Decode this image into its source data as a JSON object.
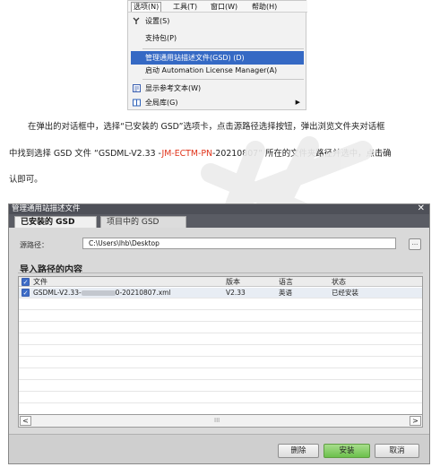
{
  "menu": {
    "bar": [
      "选项(N)",
      "工具(T)",
      "窗口(W)",
      "帮助(H)"
    ],
    "items": [
      {
        "icon": "settings-icon",
        "label": "设置(S)"
      },
      {
        "icon": "",
        "label": "支持包(P)"
      },
      {
        "icon": "",
        "label": "管理通用站描述文件(GSD) (D)"
      },
      {
        "icon": "",
        "label": "启动 Automation License Manager(A)"
      },
      {
        "icon": "reference-text-icon",
        "label": "显示参考文本(W)"
      },
      {
        "icon": "global-library-icon",
        "label": "全局库(G)"
      }
    ]
  },
  "article": {
    "line1": "在弹出的对话框中，选择“已安装的 GSD”选项卡，点击源路径选择按钮，弹出浏览文件夹对话框",
    "line2_a": "中找到选择 GSD 文件 “GSDML-V2.33 -",
    "line2_red": "JM-ECTM-PN",
    "line2_b": "-20210807” 所在的文件夹路径并选中，点击确",
    "line3": "认即可。"
  },
  "dialog": {
    "title": "管理通用站描述文件",
    "tabs": [
      "已安装的 GSD",
      "项目中的 GSD"
    ],
    "source_label": "源路径：",
    "source_path": "C:\\Users\\lhb\\Desktop",
    "browse_label": "...",
    "section_title": "导入路径的内容",
    "columns": {
      "file": "文件",
      "version": "版本",
      "language": "语言",
      "status": "状态"
    },
    "rows": [
      {
        "file_prefix": "GSDML-V2.33-",
        "file_suffix": "0-20210807.xml",
        "version": "V2.33",
        "language": "英语",
        "status": "已经安装"
      }
    ],
    "scroll_mark": "III",
    "buttons": {
      "delete": "删除",
      "install": "安装",
      "cancel": "取消"
    }
  },
  "colors": {
    "highlight": "#3569c4",
    "accent_red": "#e0331a",
    "install_green": "#6cc04c",
    "titlebar": "#4e5058"
  }
}
